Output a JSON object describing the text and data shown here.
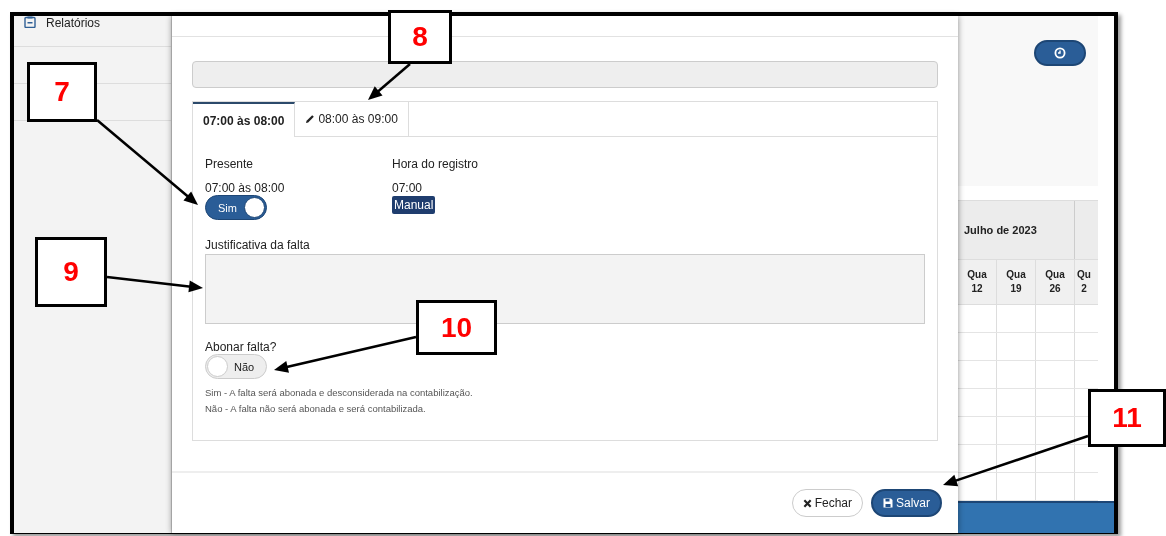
{
  "sidebar": {
    "items": [
      {
        "label": "Relatórios"
      }
    ]
  },
  "dialog": {
    "tabs": [
      {
        "label": "07:00 às 08:00",
        "selected": true,
        "edited": false
      },
      {
        "label": "08:00 às 09:00",
        "selected": false,
        "edited": true
      }
    ],
    "present": {
      "label": "Presente",
      "period": "07:00 às 08:00",
      "toggle": {
        "label": "Sim",
        "on": true
      }
    },
    "record_time": {
      "label": "Hora do registro",
      "value": "07:00",
      "badge": "Manual"
    },
    "justification": {
      "label": "Justificativa da falta"
    },
    "excuse": {
      "label": "Abonar falta?",
      "toggle": {
        "label": "Não",
        "on": false
      },
      "help": [
        "Sim - A falta será abonada e desconsiderada na contabilização.",
        "Não - A falta não será abonada e será contabilizada."
      ]
    },
    "buttons": [
      {
        "label": "Fechar",
        "kind": "secondary"
      },
      {
        "label": "Salvar",
        "kind": "primary"
      }
    ]
  },
  "calendar": {
    "month": "Julho de 2023",
    "days": [
      {
        "weekday": "Qua",
        "day": "12"
      },
      {
        "weekday": "Qua",
        "day": "19"
      },
      {
        "weekday": "Qua",
        "day": "26"
      },
      {
        "weekday": "Qu",
        "day": "2"
      }
    ]
  },
  "callouts": [
    {
      "number": "7"
    },
    {
      "number": "8"
    },
    {
      "number": "9"
    },
    {
      "number": "10"
    },
    {
      "number": "11"
    }
  ]
}
